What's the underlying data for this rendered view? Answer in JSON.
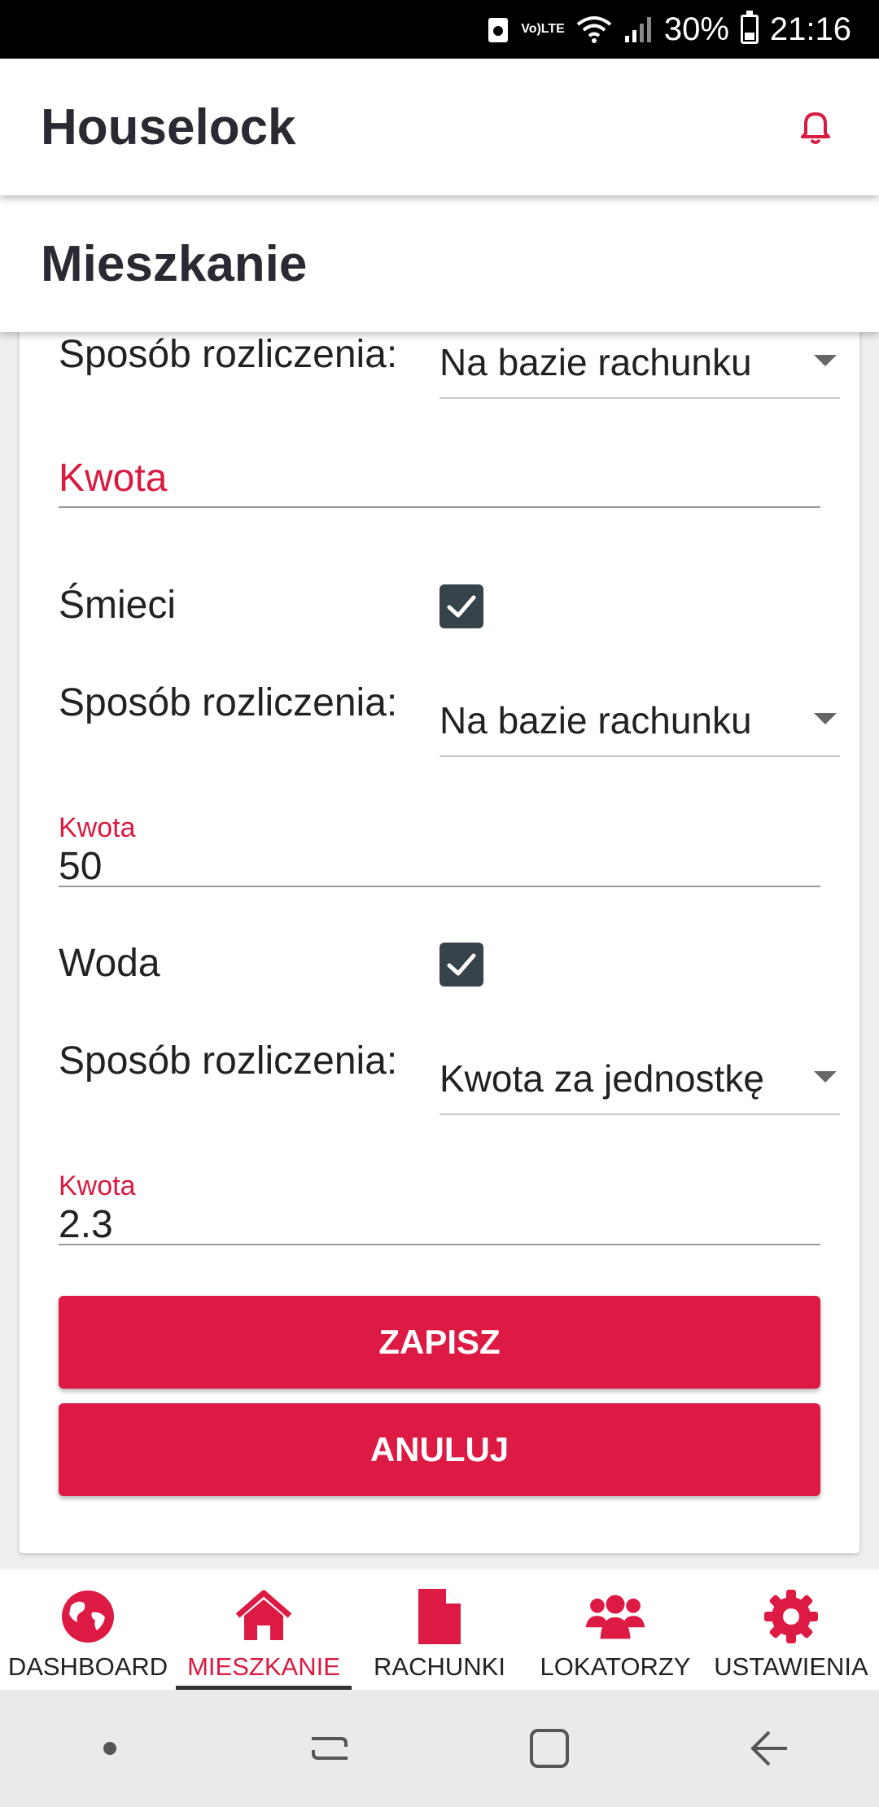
{
  "status_bar": {
    "battery": "30%",
    "time": "21:16",
    "network": "LTE"
  },
  "app_bar": {
    "title": "Houselock"
  },
  "page": {
    "title": "Mieszkanie"
  },
  "form": {
    "partial_row": {
      "settlement_label": "Sposób rozliczenia:",
      "settlement_value": "Na bazie rachunku",
      "amount_label": "Kwota",
      "amount_value": ""
    },
    "sections": [
      {
        "name": "Śmieci",
        "checked": true,
        "settlement_label": "Sposób rozliczenia:",
        "settlement_value": "Na bazie rachunku",
        "amount_label": "Kwota",
        "amount_value": "50"
      },
      {
        "name": "Woda",
        "checked": true,
        "settlement_label": "Sposób rozliczenia:",
        "settlement_value": "Kwota za jednostkę",
        "amount_label": "Kwota",
        "amount_value": "2.3"
      }
    ],
    "save_label": "ZAPISZ",
    "cancel_label": "ANULUJ"
  },
  "bottom_nav": {
    "items": [
      {
        "label": "DASHBOARD",
        "icon": "globe-icon",
        "active": false
      },
      {
        "label": "MIESZKANIE",
        "icon": "home-icon",
        "active": true
      },
      {
        "label": "RACHUNKI",
        "icon": "document-icon",
        "active": false
      },
      {
        "label": "LOKATORZY",
        "icon": "users-icon",
        "active": false
      },
      {
        "label": "USTAWIENIA",
        "icon": "gear-icon",
        "active": false
      }
    ]
  },
  "colors": {
    "accent": "#dc1a44",
    "checkbox": "#37434a",
    "text": "#222222"
  }
}
